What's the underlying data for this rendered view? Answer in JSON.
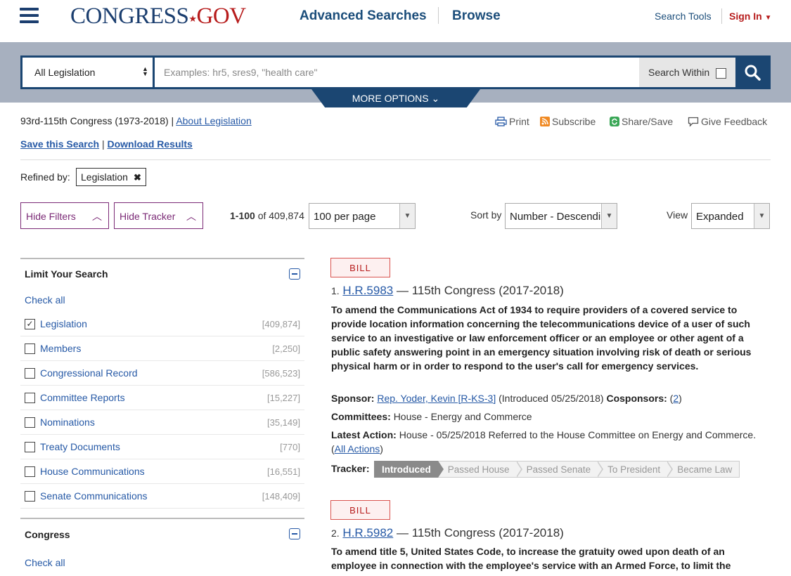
{
  "header": {
    "logo_part1": "CONGRESS",
    "logo_part2": "GOV",
    "nav": [
      "Advanced Searches",
      "Browse"
    ],
    "search_tools": "Search Tools",
    "sign_in": "Sign In"
  },
  "search": {
    "collection": "All Legislation",
    "placeholder": "Examples: hr5, sres9, \"health care\"",
    "within_label": "Search Within",
    "more_options": "MORE OPTIONS"
  },
  "info": {
    "congress_range": "93rd-115th Congress (1973-2018) |",
    "about_link": "About Legislation",
    "tools": [
      "Print",
      "Subscribe",
      "Share/Save",
      "Give Feedback"
    ],
    "save_search": "Save this Search",
    "download": "Download Results",
    "refined_by": "Refined by:",
    "refine_chip": "Legislation"
  },
  "controls": {
    "hide_filters": "Hide Filters",
    "hide_tracker": "Hide Tracker",
    "range": "1-100",
    "of_total": "of 409,874",
    "per_page": "100 per page",
    "sort_label": "Sort by",
    "sort_value": "Number - Descending",
    "view_label": "View",
    "view_value": "Expanded"
  },
  "filters": {
    "limit_title": "Limit Your Search",
    "check_all": "Check all",
    "items": [
      {
        "label": "Legislation",
        "count": "[409,874]",
        "checked": true
      },
      {
        "label": "Members",
        "count": "[2,250]",
        "checked": false
      },
      {
        "label": "Congressional Record",
        "count": "[586,523]",
        "checked": false
      },
      {
        "label": "Committee Reports",
        "count": "[15,227]",
        "checked": false
      },
      {
        "label": "Nominations",
        "count": "[35,149]",
        "checked": false
      },
      {
        "label": "Treaty Documents",
        "count": "[770]",
        "checked": false
      },
      {
        "label": "House Communications",
        "count": "[16,551]",
        "checked": false
      },
      {
        "label": "Senate Communications",
        "count": "[148,409]",
        "checked": false
      }
    ],
    "congress_title": "Congress",
    "congress_check_all": "Check all"
  },
  "results": [
    {
      "badge": "BILL",
      "index": "1.",
      "bill_id": "H.R.5983",
      "congress": "— 115th Congress (2017-2018)",
      "title": "To amend the Communications Act of 1934 to require providers of a covered service to provide location information concerning the telecommunications device of a user of such service to an investigative or law enforcement officer or an employee or other agent of a public safety answering point in an emergency situation involving risk of death or serious physical harm or in order to respond to the user's call for emergency services.",
      "sponsor_label": "Sponsor:",
      "sponsor": "Rep. Yoder, Kevin [R-KS-3]",
      "introduced": "(Introduced 05/25/2018)",
      "cosponsors_label": "Cosponsors:",
      "cosponsors": "2",
      "committees_label": "Committees:",
      "committees": "House - Energy and Commerce",
      "latest_label": "Latest Action:",
      "latest": "House - 05/25/2018 Referred to the House Committee on Energy and Commerce.",
      "all_actions": "All Actions",
      "tracker_label": "Tracker:",
      "tracker": [
        "Introduced",
        "Passed House",
        "Passed Senate",
        "To President",
        "Became Law"
      ]
    },
    {
      "badge": "BILL",
      "index": "2.",
      "bill_id": "H.R.5982",
      "congress": "— 115th Congress (2017-2018)",
      "title": "To amend title 5, United States Code, to increase the gratuity owed upon death of an employee in connection with the employee's service with an Armed Force, to limit the"
    }
  ]
}
